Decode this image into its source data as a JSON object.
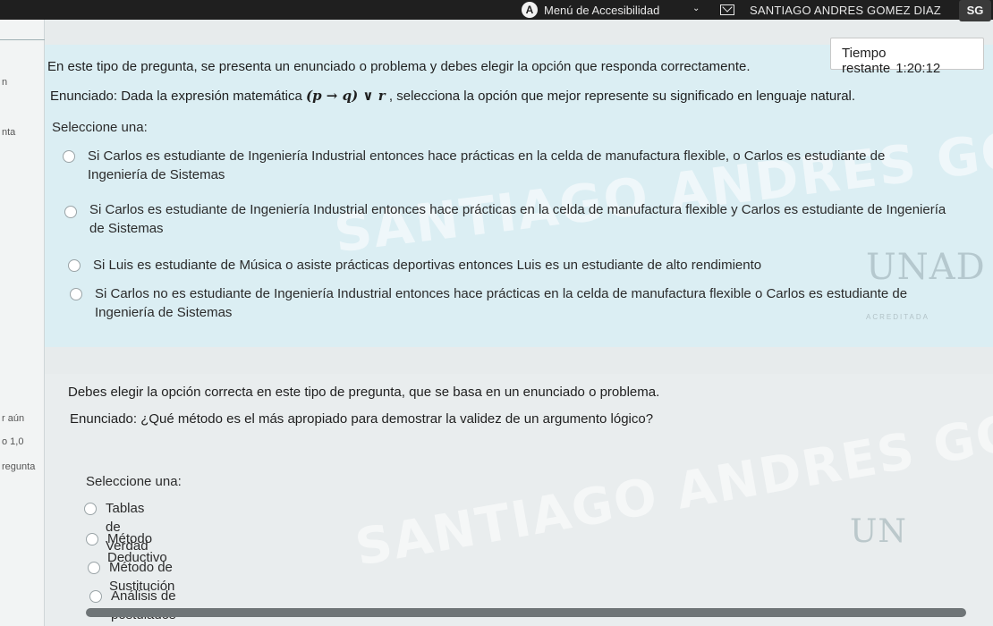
{
  "topbar": {
    "accessibility_badge": "A",
    "accessibility_menu": "Menú de Accesibilidad",
    "caret": "⌄",
    "user_name": "SANTIAGO ANDRES GOMEZ DIAZ",
    "user_initials": "SG"
  },
  "left_rail": {
    "fragments": [
      "n",
      "nta",
      "r aún",
      "o 1,0",
      "regunta"
    ]
  },
  "timer": {
    "label": "Tiempo restante",
    "value": "1:20:12"
  },
  "watermark": {
    "text": "SANTIAGO ANDRES GOMEZ DIAZ",
    "logo": "UNAD",
    "logo_short": "UN",
    "accredited": "ACREDITADA"
  },
  "question1": {
    "intro": "En este tipo de pregunta, se presenta un enunciado o problema y debes elegir la opción que responda correctamente.",
    "statement_prefix": "Enunciado: Dada la expresión matemática ",
    "expression": "(p → q) ∨ r",
    "statement_suffix": " , selecciona la opción que mejor represente su significado en lenguaje natural.",
    "select_label": "Seleccione una:",
    "options": [
      {
        "line1": "Si Carlos es estudiante de Ingeniería Industrial entonces hace prácticas en la celda de manufactura flexible, o Carlos es estudiante de",
        "line2": "Ingeniería de Sistemas"
      },
      {
        "line1": "Si Carlos es estudiante de Ingeniería Industrial entonces hace prácticas en la celda de manufactura flexible y Carlos es estudiante de Ingeniería",
        "line2": "de Sistemas"
      },
      {
        "line1": "Si Luis es estudiante de Música o asiste prácticas deportivas entonces Luis es un estudiante de alto rendimiento",
        "line2": ""
      },
      {
        "line1": "Si Carlos no es estudiante de Ingeniería Industrial entonces hace prácticas en la celda de manufactura flexible o Carlos es estudiante de",
        "line2": "Ingeniería de Sistemas"
      }
    ]
  },
  "question2": {
    "intro": "Debes elegir la opción correcta en este tipo de pregunta, que se basa en un enunciado o problema.",
    "statement": "Enunciado: ¿Qué método es el más apropiado para demostrar la validez de un argumento lógico?",
    "select_label": "Seleccione una:",
    "options": [
      "Tablas de Verdad",
      "Método Deductivo",
      "Método de Sustitución",
      "Análisis de postulados"
    ]
  }
}
